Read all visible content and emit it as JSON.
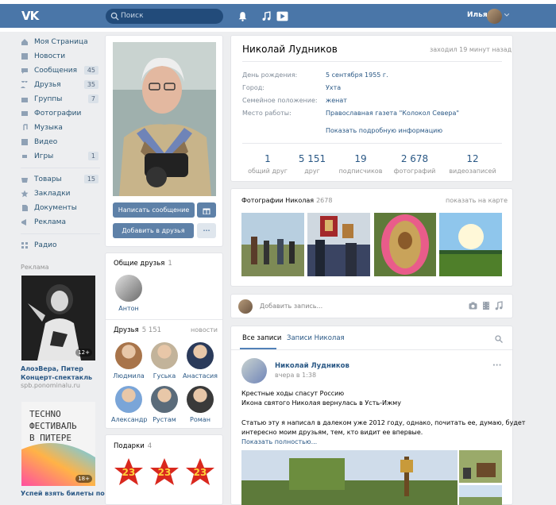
{
  "header": {
    "search_placeholder": "Поиск",
    "user_name": "Илья",
    "colors": {
      "bar": "#4a76a8",
      "search": "#224b7a"
    }
  },
  "sidebar": {
    "items": [
      {
        "label": "Моя Страница",
        "icon": "home-icon",
        "count": ""
      },
      {
        "label": "Новости",
        "icon": "news-icon",
        "count": ""
      },
      {
        "label": "Сообщения",
        "icon": "messages-icon",
        "count": "45"
      },
      {
        "label": "Друзья",
        "icon": "friends-icon",
        "count": "35"
      },
      {
        "label": "Группы",
        "icon": "groups-icon",
        "count": "7"
      },
      {
        "label": "Фотографии",
        "icon": "photos-icon",
        "count": ""
      },
      {
        "label": "Музыка",
        "icon": "music-icon",
        "count": ""
      },
      {
        "label": "Видео",
        "icon": "video-icon",
        "count": ""
      },
      {
        "label": "Игры",
        "icon": "games-icon",
        "count": "1"
      }
    ],
    "items2": [
      {
        "label": "Товары",
        "icon": "goods-icon",
        "count": "15"
      },
      {
        "label": "Закладки",
        "icon": "bookmarks-icon",
        "count": ""
      },
      {
        "label": "Документы",
        "icon": "documents-icon",
        "count": ""
      },
      {
        "label": "Реклама",
        "icon": "ads-icon",
        "count": ""
      }
    ],
    "items3": [
      {
        "label": "Радио",
        "icon": "radio-icon",
        "count": ""
      }
    ],
    "ad_label": "Реклама",
    "ad1": {
      "title_line1": "АлоэВера, Питер",
      "title_line2": "Концерт-спектакль",
      "url": "spb.ponominalu.ru",
      "badge": "12+"
    },
    "ad2": {
      "line1": "TECHNO",
      "line2": "ФЕСТИВАЛЬ",
      "line3": "В ПИТЕРЕ",
      "badge": "18+",
      "title": "Успей взять билеты по"
    }
  },
  "profile": {
    "send_message": "Написать сообщение",
    "add_friend": "Добавить в друзья",
    "more": "···"
  },
  "common_friends": {
    "title": "Общие друзья",
    "count": "1",
    "items": [
      {
        "name": "Антон"
      }
    ]
  },
  "friends": {
    "title": "Друзья",
    "count": "5 151",
    "updates": "новости",
    "items": [
      {
        "name": "Людмила"
      },
      {
        "name": "Гуська"
      },
      {
        "name": "Анастасия"
      },
      {
        "name": "Александр"
      },
      {
        "name": "Рустам"
      },
      {
        "name": "Роман"
      }
    ]
  },
  "gifts": {
    "title": "Подарки",
    "count": "4",
    "label": "23"
  },
  "info": {
    "name": "Николай Лудников",
    "online": "заходил 19 минут назад",
    "rows": [
      {
        "label": "День рождения:",
        "value": "5 сентября 1955 г."
      },
      {
        "label": "Город:",
        "value": "Ухта"
      },
      {
        "label": "Семейное положение:",
        "value": "женат"
      },
      {
        "label": "Место работы:",
        "value": "Православная газета \"Колокол Севера\""
      }
    ],
    "more": "Показать подробную информацию",
    "stats": [
      {
        "value": "1",
        "label": "общий друг"
      },
      {
        "value": "5 151",
        "label": "друг"
      },
      {
        "value": "19",
        "label": "подписчиков"
      },
      {
        "value": "2 678",
        "label": "фотографий"
      },
      {
        "value": "12",
        "label": "видеозаписей"
      }
    ]
  },
  "photos": {
    "title": "Фотографии Николая",
    "count": "2678",
    "map": "показать на карте"
  },
  "composer": {
    "placeholder": "Добавить запись..."
  },
  "wall": {
    "tabs": [
      "Все записи",
      "Записи Николая"
    ],
    "post": {
      "author": "Николай Лудников",
      "time": "вчера в 1:38",
      "line1": "Крестные ходы спасут Россию",
      "line2": "Икона святого Николая вернулась в Усть-Ижму",
      "line3": "Статью эту я написал в далеком уже 2012 году, однако, почитать ее, думаю, будет",
      "line4": "интересно моим друзьям, тем, кто видит ее впервые.",
      "more": "Показать полностью..."
    }
  }
}
